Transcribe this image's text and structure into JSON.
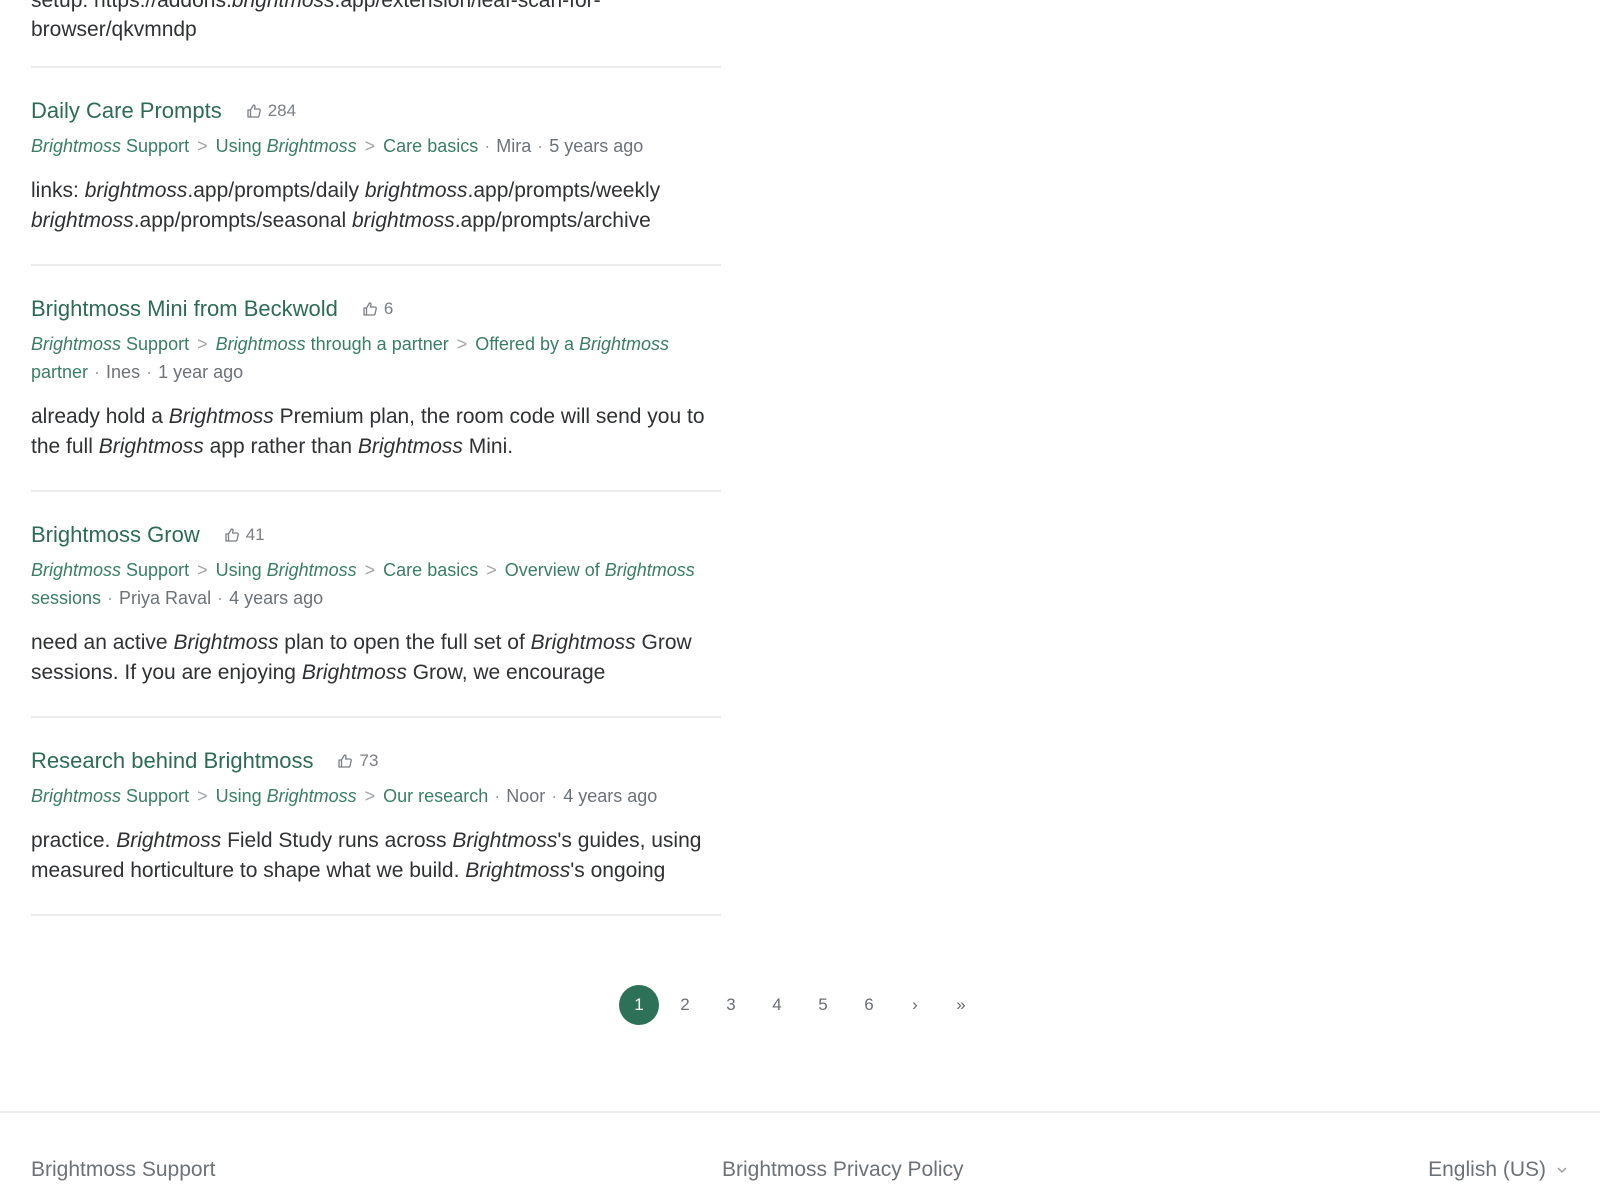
{
  "top_result": {
    "excerpt_line1_prefix": "setup: https://addons.",
    "excerpt_line1_brand": "brightmoss",
    "excerpt_line1_suffix": ".app/extension/leaf-scan-for-",
    "excerpt_line2": "browser/qkvmndp"
  },
  "results": [
    {
      "title": "Daily Care Prompts",
      "votes": "284",
      "crumbs": [
        {
          "brand": "Brightmoss",
          "text": " Support"
        },
        {
          "pre": "Using ",
          "brand": "Brightmoss",
          "text": ""
        },
        {
          "text": "Care basics"
        }
      ],
      "author": "Mira",
      "time": "5 years ago",
      "excerpt": [
        {
          "t": "links: "
        },
        {
          "b": "brightmoss"
        },
        {
          "t": ".app/prompts/daily "
        },
        {
          "b": "brightmoss"
        },
        {
          "t": ".app/prompts/weekly "
        },
        {
          "b": "brightmoss"
        },
        {
          "t": ".app/prompts/seasonal "
        },
        {
          "b": "brightmoss"
        },
        {
          "t": ".app/prompts/archive"
        }
      ]
    },
    {
      "title": "Brightmoss Mini from Beckwold",
      "votes": "6",
      "crumbs": [
        {
          "brand": "Brightmoss",
          "text": " Support"
        },
        {
          "brand": "Brightmoss",
          "text": " through a partner"
        },
        {
          "pre": "Offered by a ",
          "brand": "Brightmoss",
          "text": " partner"
        }
      ],
      "author": "Ines",
      "time": "1 year ago",
      "excerpt": [
        {
          "t": "already hold a "
        },
        {
          "b": "Brightmoss"
        },
        {
          "t": " Premium plan, the room code will send you to the full "
        },
        {
          "b": "Brightmoss"
        },
        {
          "t": " app rather than "
        },
        {
          "b": "Brightmoss"
        },
        {
          "t": " Mini."
        }
      ]
    },
    {
      "title": "Brightmoss Grow",
      "votes": "41",
      "crumbs": [
        {
          "brand": "Brightmoss",
          "text": " Support"
        },
        {
          "pre": "Using ",
          "brand": "Brightmoss",
          "text": ""
        },
        {
          "text": "Care basics"
        },
        {
          "pre": "Overview of ",
          "brand": "Brightmoss",
          "text": " sessions"
        }
      ],
      "author": "Priya Raval",
      "time": "4 years ago",
      "excerpt": [
        {
          "t": "need an active "
        },
        {
          "b": "Brightmoss"
        },
        {
          "t": " plan to open the full set of "
        },
        {
          "b": "Brightmoss"
        },
        {
          "t": " Grow sessions. If you are enjoying "
        },
        {
          "b": "Brightmoss"
        },
        {
          "t": " Grow, we encourage"
        }
      ]
    },
    {
      "title": "Research behind Brightmoss",
      "votes": "73",
      "crumbs": [
        {
          "brand": "Brightmoss",
          "text": " Support"
        },
        {
          "pre": "Using ",
          "brand": "Brightmoss",
          "text": ""
        },
        {
          "text": "Our research"
        }
      ],
      "author": "Noor",
      "time": "4 years ago",
      "excerpt": [
        {
          "t": "practice. "
        },
        {
          "b": "Brightmoss"
        },
        {
          "t": " Field Study runs across "
        },
        {
          "b": "Brightmoss"
        },
        {
          "t": "'s guides, using measured horticulture to shape what we build. "
        },
        {
          "b": "Brightmoss"
        },
        {
          "t": "'s ongoing"
        }
      ]
    }
  ],
  "pagination": {
    "pages": [
      "1",
      "2",
      "3",
      "4",
      "5",
      "6"
    ],
    "current": "1",
    "next": "›",
    "last": "»"
  },
  "footer": {
    "brand_link": "Brightmoss Support",
    "privacy_link": "Brightmoss Privacy Policy",
    "language": "English (US)"
  },
  "icons": {
    "votes": "thumbs-up-icon",
    "language": "chevron-down-icon"
  },
  "colors": {
    "accent": "#2e7159",
    "link": "#2e6b57",
    "divider": "#ececec"
  }
}
